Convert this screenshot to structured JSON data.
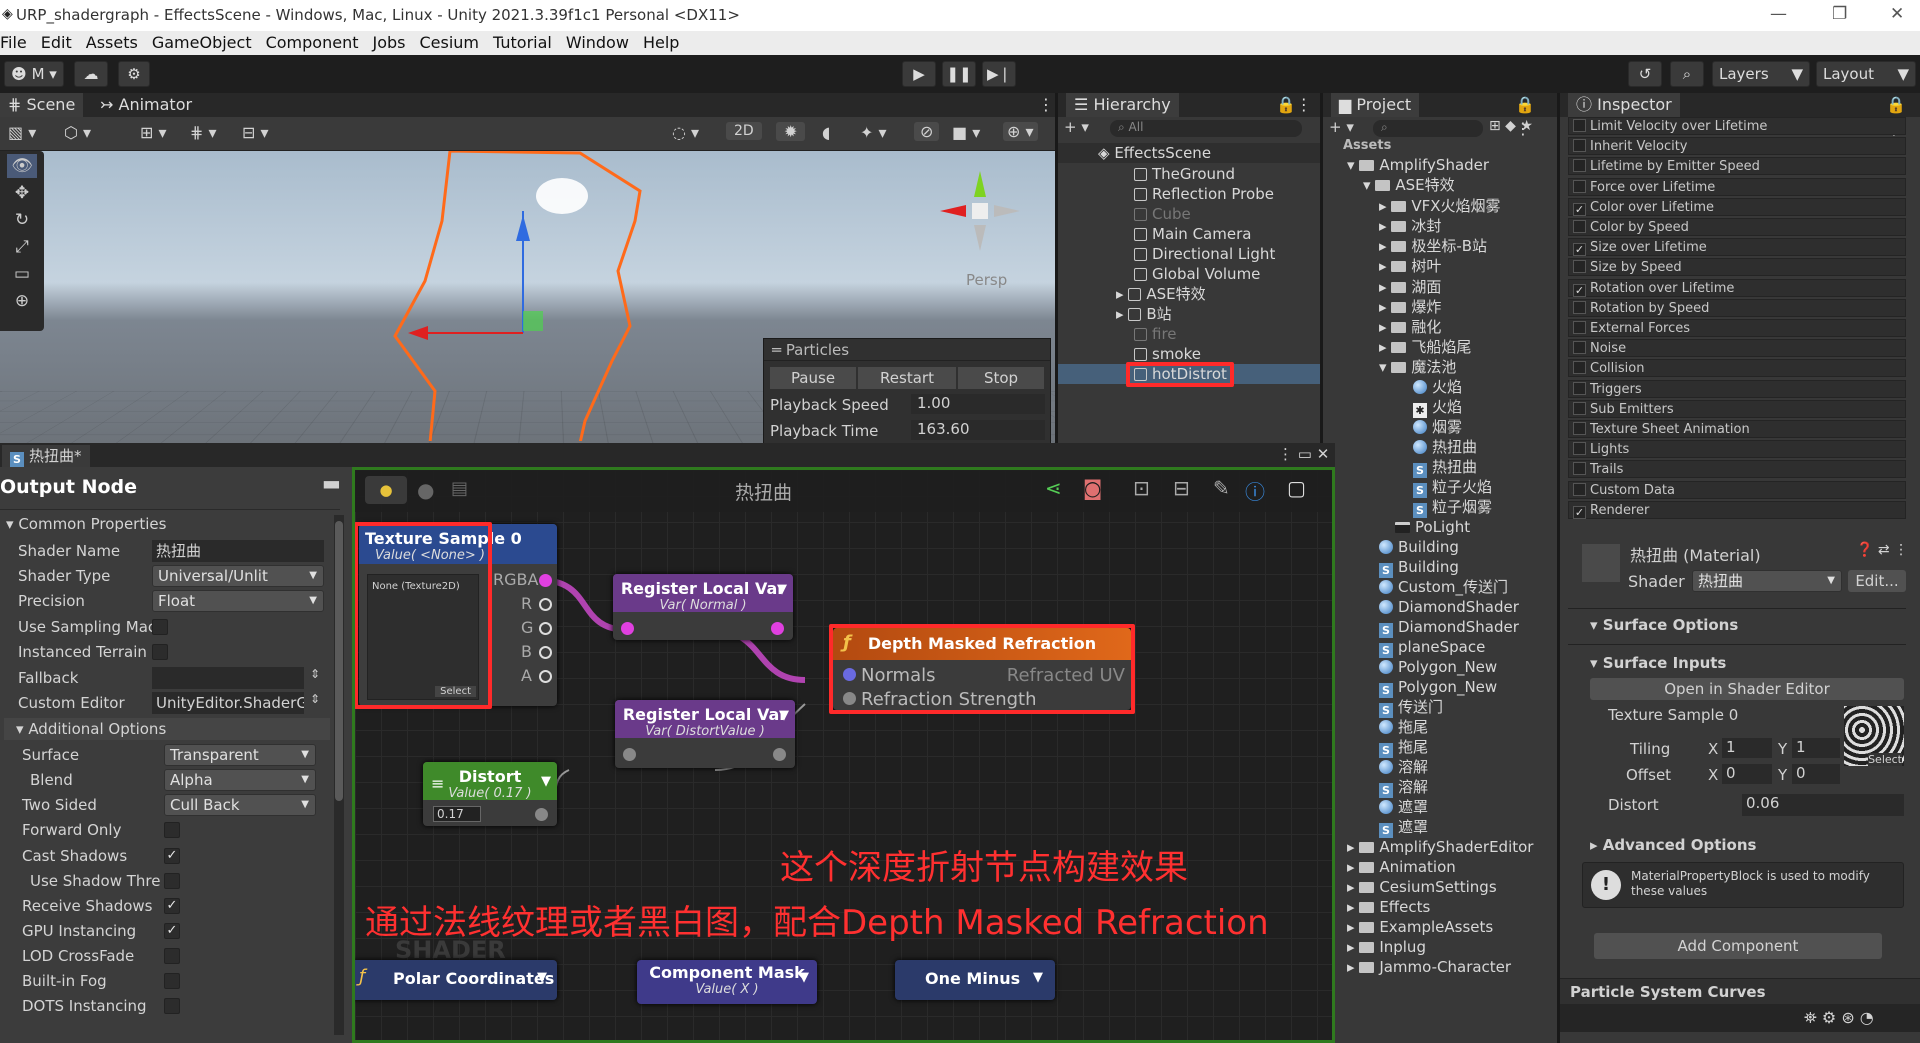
{
  "window": {
    "title": "URP_shadergraph - EffectsScene - Windows, Mac, Linux - Unity 2021.3.39f1c1 Personal <DX11>",
    "controls": [
      "—",
      "❐",
      "✕"
    ]
  },
  "menu": [
    "File",
    "Edit",
    "Assets",
    "GameObject",
    "Component",
    "Jobs",
    "Cesium",
    "Tutorial",
    "Window",
    "Help"
  ],
  "toolbar": {
    "account": "M",
    "layers": "Layers",
    "layout": "Layout"
  },
  "scene": {
    "tab_scene": "Scene",
    "tab_animator": "Animator",
    "mode_2d": "2D",
    "persp": "Persp"
  },
  "particles": {
    "title": "Particles",
    "pause": "Pause",
    "restart": "Restart",
    "stop": "Stop",
    "speed_label": "Playback Speed",
    "speed_value": "1.00",
    "time_label": "Playback Time",
    "time_value": "163.60"
  },
  "hierarchy": {
    "tab": "Hierarchy",
    "search_placeholder": "All",
    "scene": "EffectsScene",
    "items": [
      {
        "name": "TheGround",
        "dim": false
      },
      {
        "name": "Reflection Probe",
        "dim": false
      },
      {
        "name": "Cube",
        "dim": true
      },
      {
        "name": "Main Camera",
        "dim": false
      },
      {
        "name": "Directional Light",
        "dim": false
      },
      {
        "name": "Global Volume",
        "dim": false
      },
      {
        "name": "ASE特效",
        "dim": false
      },
      {
        "name": "B站",
        "dim": false
      },
      {
        "name": "fire",
        "dim": true
      },
      {
        "name": "smoke",
        "dim": false
      },
      {
        "name": "hotDistrot",
        "dim": false
      }
    ]
  },
  "project": {
    "tab": "Project",
    "root": "Assets",
    "items": [
      "AmplifyShader",
      "ASE特效",
      "VFX火焰烟雾",
      "冰封",
      "极坐标-B站",
      "树叶",
      "湖面",
      "爆炸",
      "融化",
      "飞船焰尾",
      "魔法池",
      "火焰",
      "火焰",
      "烟雾",
      "热扭曲",
      "热扭曲",
      "粒子火焰",
      "粒子烟雾",
      "PoLight",
      "Building",
      "Building",
      "Custom_传送门",
      "DiamondShader",
      "DiamondShader",
      "planeSpace",
      "Polygon_New",
      "Polygon_New",
      "传送门",
      "拖尾",
      "拖尾",
      "溶解",
      "溶解",
      "遮罩",
      "遮罩",
      "AmplifyShaderEditor",
      "Animation",
      "CesiumSettings",
      "Effects",
      "ExampleAssets",
      "Inplug",
      "Jammo-Character"
    ]
  },
  "inspector": {
    "tab": "Inspector",
    "modules": [
      {
        "name": "Limit Velocity over Lifetime",
        "on": false
      },
      {
        "name": "Inherit Velocity",
        "on": false
      },
      {
        "name": "Lifetime by Emitter Speed",
        "on": false
      },
      {
        "name": "Force over Lifetime",
        "on": false
      },
      {
        "name": "Color over Lifetime",
        "on": true
      },
      {
        "name": "Color by Speed",
        "on": false
      },
      {
        "name": "Size over Lifetime",
        "on": true
      },
      {
        "name": "Size by Speed",
        "on": false
      },
      {
        "name": "Rotation over Lifetime",
        "on": true
      },
      {
        "name": "Rotation by Speed",
        "on": false
      },
      {
        "name": "External Forces",
        "on": false
      },
      {
        "name": "Noise",
        "on": false
      },
      {
        "name": "Collision",
        "on": false
      },
      {
        "name": "Triggers",
        "on": false
      },
      {
        "name": "Sub Emitters",
        "on": false
      },
      {
        "name": "Texture Sheet Animation",
        "on": false
      },
      {
        "name": "Lights",
        "on": false
      },
      {
        "name": "Trails",
        "on": false
      },
      {
        "name": "Custom Data",
        "on": false
      },
      {
        "name": "Renderer",
        "on": true
      }
    ],
    "material": "热扭曲 (Material)",
    "shader_label": "Shader",
    "shader_value": "热扭曲",
    "edit": "Edit...",
    "surface_options": "Surface Options",
    "surface_inputs": "Surface Inputs",
    "open_editor": "Open in Shader Editor",
    "tex_label": "Texture Sample 0",
    "tiling": "Tiling",
    "offset": "Offset",
    "tx": "1",
    "ty": "1",
    "ox": "0",
    "oy": "0",
    "x": "X",
    "y": "Y",
    "select": "Select",
    "distort_label": "Distort",
    "distort_value": "0.06",
    "advanced": "Advanced Options",
    "help": "MaterialPropertyBlock is used to modify these values",
    "add_component": "Add Component",
    "curves": "Particle System Curves"
  },
  "shader_graph": {
    "tab": "热扭曲*",
    "title": "热扭曲"
  },
  "output": {
    "title": "Output Node",
    "common": "Common Properties",
    "shader_name_label": "Shader Name",
    "shader_name": "热扭曲",
    "shader_type_label": "Shader Type",
    "shader_type": "Universal/Unlit",
    "precision_label": "Precision",
    "precision": "Float",
    "use_sampling": "Use Sampling Mac",
    "instanced": "Instanced Terrain",
    "fallback": "Fallback",
    "custom_editor_label": "Custom Editor",
    "custom_editor": "UnityEditor.ShaderG",
    "additional": "Additional Options",
    "surface_label": "Surface",
    "surface": "Transparent",
    "blend_label": "Blend",
    "blend": "Alpha",
    "two_sided_label": "Two Sided",
    "two_sided": "Cull Back",
    "forward_only": "Forward Only",
    "cast_shadows": "Cast Shadows",
    "use_shadow": "Use Shadow Thre",
    "receive_shadows": "Receive Shadows",
    "gpu_instancing": "GPU Instancing",
    "lod_crossfade": "LOD CrossFade",
    "builtin_fog": "Built-in Fog",
    "dots": "DOTS Instancing"
  },
  "nodes": {
    "tex": {
      "title": "Texture Sample 0",
      "sub": "Value( <None> )",
      "none": "None (Texture2D)",
      "select": "Select",
      "ports": [
        "RGBA",
        "R",
        "G",
        "B",
        "A"
      ]
    },
    "reg1": {
      "title": "Register Local Var",
      "sub": "Var( Normal )"
    },
    "reg2": {
      "title": "Register Local Var",
      "sub": "Var( DistortValue )"
    },
    "distort": {
      "title": "Distort",
      "sub": "Value( 0.17 )",
      "value": "0.17"
    },
    "dmr": {
      "title": "Depth Masked Refraction",
      "in1": "Normals",
      "in2": "Refraction Strength",
      "out": "Refracted UV"
    },
    "polar": {
      "title": "Polar Coordinates"
    },
    "mask": {
      "title": "Component Mask",
      "sub": "Value( X )"
    },
    "oneminus": {
      "title": "One Minus"
    },
    "shader_watermark": "SHADER"
  },
  "annotations": {
    "line1": "这个深度折射节点构建效果",
    "line2": "通过法线纹理或者黑白图，配合Depth Masked Refraction"
  }
}
